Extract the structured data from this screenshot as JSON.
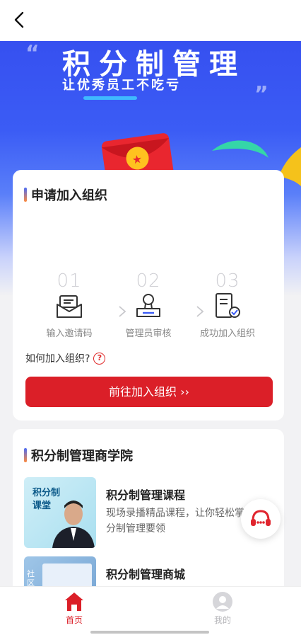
{
  "banner": {
    "title": "积分制管理",
    "subtitle": "让优秀员工不吃亏",
    "quote_open": "“",
    "quote_close": "”"
  },
  "join_card": {
    "title": "申请加入组织",
    "steps": [
      {
        "num": "01",
        "label": "输入邀请码",
        "icon": "envelope-icon"
      },
      {
        "num": "02",
        "label": "管理员审核",
        "icon": "stamp-icon"
      },
      {
        "num": "03",
        "label": "成功加入组织",
        "icon": "document-check-icon"
      }
    ],
    "how_text": "如何加入组织?",
    "how_icon": "?",
    "button_label": "前往加入组织 ››"
  },
  "academy": {
    "title": "积分制管理商学院",
    "items": [
      {
        "title": "积分制管理课程",
        "desc": "现场录播精品课程，让你轻松掌握积分制管理要领",
        "thumb_text": "积分制\n课堂"
      },
      {
        "title": "积分制管理商城",
        "desc": "",
        "thumb_text": "社区书籍"
      }
    ]
  },
  "tabbar": {
    "home": "首页",
    "mine": "我的"
  },
  "colors": {
    "accent": "#db1f28",
    "banner_blue": "#3b5cf5"
  }
}
